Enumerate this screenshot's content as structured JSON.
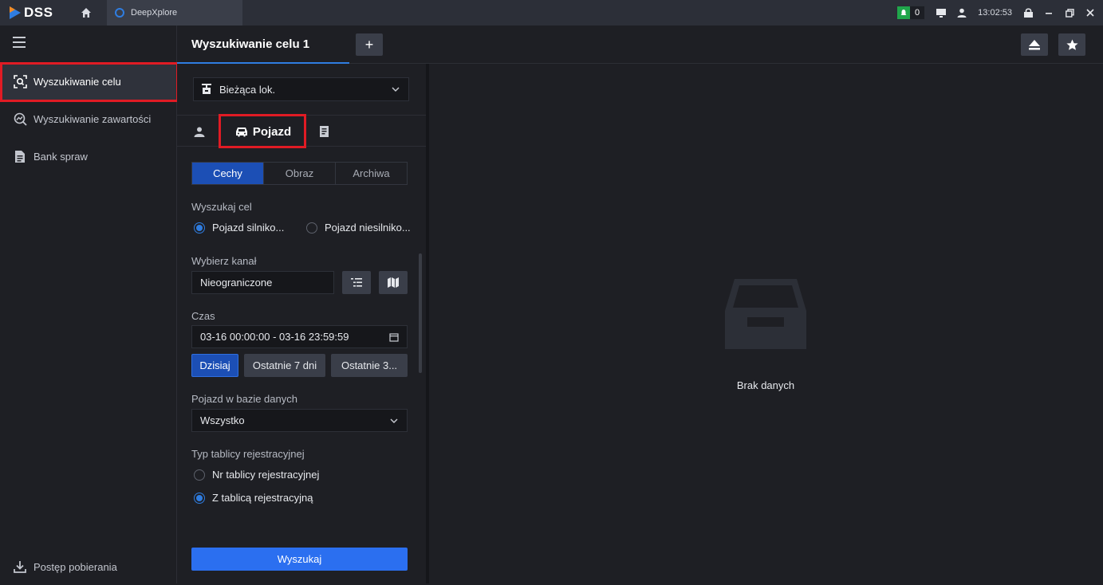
{
  "titlebar": {
    "logo_text": "DSS",
    "app_tab_label": "DeepXplore",
    "notification_count": "0",
    "clock": "13:02:53"
  },
  "sidenav": {
    "items": [
      {
        "label": "Wyszukiwanie celu",
        "icon": "target-search-icon"
      },
      {
        "label": "Wyszukiwanie zawartości",
        "icon": "content-search-icon"
      },
      {
        "label": "Bank spraw",
        "icon": "case-bank-icon"
      }
    ],
    "download_label": "Postęp pobierania"
  },
  "tabs": {
    "active_tab": "Wyszukiwanie celu 1",
    "add_symbol": "+"
  },
  "form": {
    "location": "Bieżąca lok.",
    "type_tab_vehicle": "Pojazd",
    "segments": [
      "Cechy",
      "Obraz",
      "Archiwa"
    ],
    "search_target_label": "Wyszukaj cel",
    "target_options": [
      "Pojazd silniko...",
      "Pojazd niesilniko..."
    ],
    "channel_label": "Wybierz kanał",
    "channel_value": "Nieograniczone",
    "time_label": "Czas",
    "time_value": "03-16 00:00:00 - 03-16 23:59:59",
    "quick_ranges": [
      "Dzisiaj",
      "Ostatnie 7 dni",
      "Ostatnie 3..."
    ],
    "vehicle_db_label": "Pojazd w bazie danych",
    "vehicle_db_value": "Wszystko",
    "plate_type_label": "Typ tablicy rejestracyjnej",
    "plate_options": [
      "Nr tablicy rejestracyjnej",
      "Z tablicą rejestracyjną"
    ],
    "search_button": "Wyszukaj"
  },
  "results": {
    "empty_text": "Brak danych"
  },
  "colors": {
    "accent": "#2b6ff0",
    "highlight": "#e01b24",
    "notification": "#20a64b"
  }
}
